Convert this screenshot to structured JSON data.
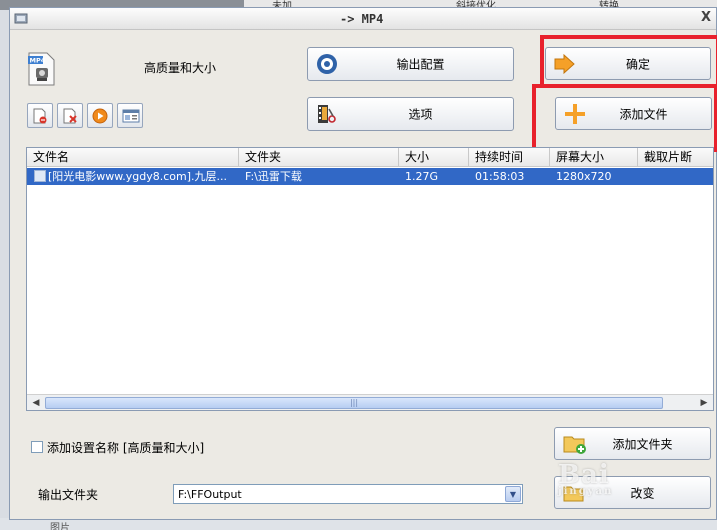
{
  "background": {
    "top_labels": [
      "未加",
      "斜接优化",
      "转换"
    ],
    "bottom_label": "图片"
  },
  "window": {
    "title": "-> MP4",
    "close_label": "X"
  },
  "profile": {
    "icon_label": "MP4",
    "name": "高质量和大小"
  },
  "buttons": {
    "output_config": "输出配置",
    "options": "选项",
    "confirm": "确定",
    "add_file": "添加文件",
    "add_folder": "添加文件夹",
    "change": "改变"
  },
  "table": {
    "columns": [
      "文件名",
      "文件夹",
      "大小",
      "持续时间",
      "屏幕大小",
      "截取片断"
    ],
    "rows": [
      {
        "filename": "[阳光电影www.ygdy8.com].九层...",
        "folder": "F:\\迅雷下载",
        "size": "1.27G",
        "duration": "01:58:03",
        "screen_size": "1280x720",
        "clip": ""
      }
    ],
    "scroll_grip": "|||"
  },
  "settings": {
    "add_setting_name_label": "添加设置名称 [高质量和大小]",
    "add_setting_name_checked": false
  },
  "output": {
    "label": "输出文件夹",
    "folder": "F:\\FFOutput"
  },
  "watermark": {
    "text": "Bai",
    "sub": "jingyan"
  },
  "colors": {
    "selection": "#3168c6",
    "highlight": "#e8212c",
    "add_plus": "#f5a028"
  }
}
